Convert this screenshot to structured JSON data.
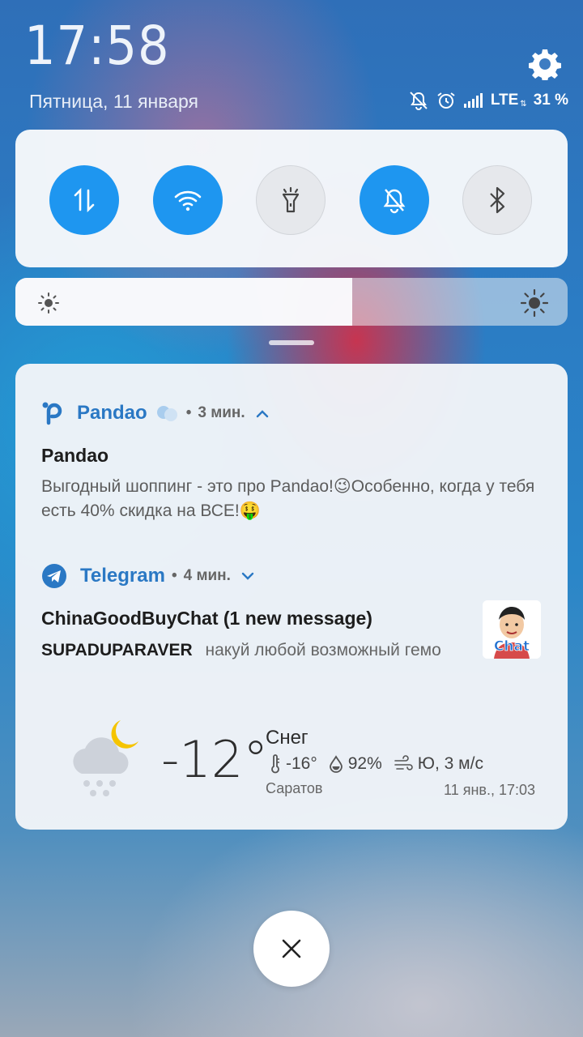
{
  "status": {
    "clock": "17:58",
    "date": "Пятница, 11 января",
    "network": "LTE",
    "network_sub": "⇅",
    "battery": "31 %"
  },
  "toggles": [
    {
      "name": "mobile-data",
      "icon": "data-transfer-icon",
      "state": "on"
    },
    {
      "name": "wifi",
      "icon": "wifi-icon",
      "state": "on"
    },
    {
      "name": "flashlight",
      "icon": "flashlight-icon",
      "state": "off"
    },
    {
      "name": "silent",
      "icon": "bell-off-icon",
      "state": "on"
    },
    {
      "name": "bluetooth",
      "icon": "bluetooth-icon",
      "state": "off"
    }
  ],
  "brightness": {
    "level": 0.61
  },
  "notifications": {
    "pandao": {
      "app": "Pandao",
      "time": "3 мин.",
      "title": "Pandao",
      "body": "Выгодный шоппинг - это про Pandao!😉Особенно, когда у тебя есть 40% скидка на ВСЕ!🤑"
    },
    "telegram": {
      "app": "Telegram",
      "time": "4 мин.",
      "title": "ChinaGoodBuyChat (1 new message)",
      "sender": "SUPADUPARAVER",
      "message": "накуй любой возможный гемо",
      "thumb_text": "Chat"
    }
  },
  "weather": {
    "temperature": "-12°",
    "condition": "Снег",
    "feels_like": "-16°",
    "humidity": "92%",
    "wind": "Ю, 3 м/с",
    "city": "Саратов",
    "updated": "11 янв., 17:03"
  },
  "colors": {
    "accent": "#1e96f0",
    "app_name": "#2a78c4"
  }
}
